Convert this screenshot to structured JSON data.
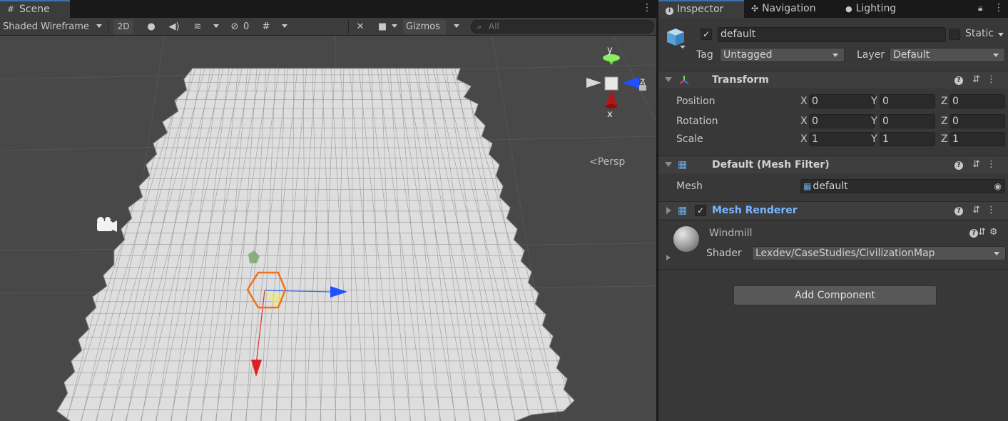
{
  "scene": {
    "tab_label": "Scene",
    "toolbar": {
      "draw_mode": "Shaded Wireframe",
      "two_d_label": "2D",
      "hidden_count": "0",
      "gizmos_label": "Gizmos",
      "search_placeholder": "All"
    },
    "view": {
      "persp_label": "Persp",
      "axis_y": "y",
      "axis_z": "z",
      "axis_x": "x"
    }
  },
  "inspector": {
    "tabs": [
      {
        "label": "Inspector",
        "icon": "info-icon"
      },
      {
        "label": "Navigation",
        "icon": "navigation-icon"
      },
      {
        "label": "Lighting",
        "icon": "lightbulb-icon"
      }
    ],
    "object": {
      "name": "default",
      "active": true,
      "static_label": "Static",
      "tag_label": "Tag",
      "tag_value": "Untagged",
      "layer_label": "Layer",
      "layer_value": "Default"
    },
    "transform": {
      "title": "Transform",
      "position": {
        "label": "Position",
        "x": "0",
        "y": "0",
        "z": "0"
      },
      "rotation": {
        "label": "Rotation",
        "x": "0",
        "y": "0",
        "z": "0"
      },
      "scale": {
        "label": "Scale",
        "x": "1",
        "y": "1",
        "z": "1"
      },
      "axis_labels": {
        "x": "X",
        "y": "Y",
        "z": "Z"
      }
    },
    "mesh_filter": {
      "title": "Default (Mesh Filter)",
      "mesh_label": "Mesh",
      "mesh_value": "default"
    },
    "mesh_renderer": {
      "title": "Mesh Renderer",
      "enabled": true
    },
    "material": {
      "name": "Windmill",
      "shader_label": "Shader",
      "shader_value": "Lexdev/CaseStudies/CivilizationMap"
    },
    "add_component_label": "Add Component"
  },
  "colors": {
    "accent": "#3a72b0",
    "mesh_renderer_title": "#7ab4ff",
    "selection_hex": "#f07020"
  }
}
